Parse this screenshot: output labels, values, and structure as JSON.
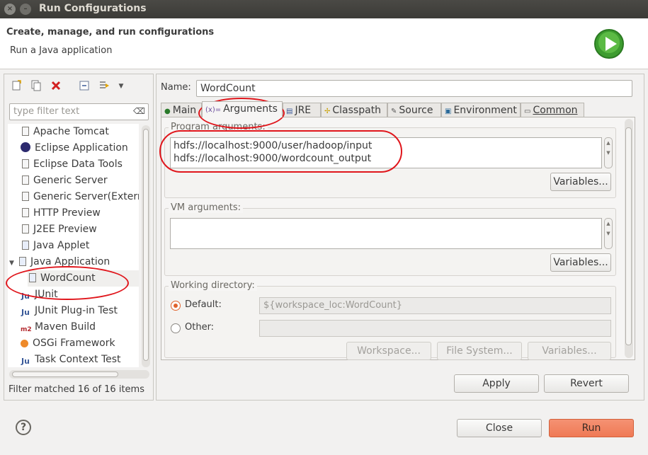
{
  "window": {
    "title": "Run Configurations",
    "close_glyph": "×",
    "minimize_glyph": "–"
  },
  "header": {
    "title": "Create, manage, and run configurations",
    "subtitle": "Run a Java application"
  },
  "left": {
    "filter_placeholder": "type filter text",
    "filter_clear_glyph": "⌫",
    "items": [
      {
        "label": "Apache Tomcat",
        "icon": "document-icon"
      },
      {
        "label": "Eclipse Application",
        "icon": "eclipse-icon"
      },
      {
        "label": "Eclipse Data Tools",
        "icon": "document-icon"
      },
      {
        "label": "Generic Server",
        "icon": "document-icon"
      },
      {
        "label": "Generic Server(Externa",
        "icon": "document-icon"
      },
      {
        "label": "HTTP Preview",
        "icon": "document-icon"
      },
      {
        "label": "J2EE Preview",
        "icon": "document-icon"
      },
      {
        "label": "Java Applet",
        "icon": "applet-icon"
      },
      {
        "label": "Java Application",
        "icon": "java-application-icon"
      },
      {
        "label": "WordCount",
        "icon": "java-class-icon"
      },
      {
        "label": "JUnit",
        "icon": "junit-icon"
      },
      {
        "label": "JUnit Plug-in Test",
        "icon": "junit-plugin-icon"
      },
      {
        "label": "Maven Build",
        "icon": "maven-icon"
      },
      {
        "label": "OSGi Framework",
        "icon": "osgi-icon"
      },
      {
        "label": "Task Context Test",
        "icon": "task-context-icon"
      }
    ],
    "status": "Filter matched 16 of 16 items"
  },
  "right": {
    "name_label": "Name:",
    "name_value": "WordCount",
    "tabs": [
      "Main",
      "Arguments",
      "JRE",
      "Classpath",
      "Source",
      "Environment",
      "Common"
    ],
    "active_tab": "Arguments",
    "program_args_label": "Program arguments:",
    "program_args_lines": [
      "hdfs://localhost:9000/user/hadoop/input",
      "hdfs://localhost:9000/wordcount_output"
    ],
    "vm_args_label": "VM arguments:",
    "vm_args_value": "",
    "variables_label": "Variables...",
    "working_dir_label": "Working directory:",
    "default_label": "Default:",
    "default_value": "${workspace_loc:WordCount}",
    "other_label": "Other:",
    "other_value": "",
    "workspace_btn": "Workspace...",
    "filesystem_btn": "File System...",
    "apply_btn": "Apply",
    "revert_btn": "Revert"
  },
  "footer": {
    "help_glyph": "?",
    "close_btn": "Close",
    "run_btn": "Run"
  },
  "colors": {
    "run_button": "#ef7a55",
    "annotation": "#e0161c",
    "selection": "#f0efed"
  }
}
